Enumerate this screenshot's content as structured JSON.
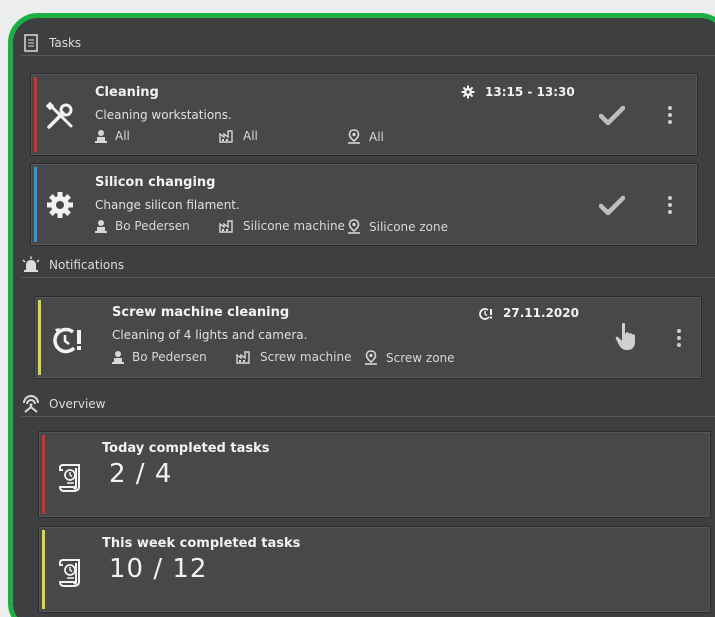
{
  "sections": {
    "tasks": "Tasks",
    "notifications": "Notifications",
    "overview": "Overview"
  },
  "tasks": [
    {
      "title": "Cleaning",
      "description": "Cleaning workstations.",
      "time": "13:15 - 13:30",
      "person": "All",
      "machine": "All",
      "zone": "All",
      "stripe_color": "#d32f2f",
      "icon": "tools-icon"
    },
    {
      "title": "Silicon changing",
      "description": "Change silicon filament.",
      "time": "",
      "person": "Bo Pedersen",
      "machine": "Silicone machine",
      "zone": "Silicone zone",
      "stripe_color": "#2f9ad3",
      "icon": "gear-icon"
    }
  ],
  "notifications": [
    {
      "title": "Screw machine cleaning",
      "description": "Cleaning of 4 lights and camera.",
      "date": "27.11.2020",
      "person": "Bo Pedersen",
      "machine": "Screw machine",
      "zone": "Screw zone",
      "stripe_color": "#d8d840",
      "icon": "alarm-clock-icon"
    }
  ],
  "overview": [
    {
      "title": "Today completed tasks",
      "value": "2 / 4",
      "stripe_color": "#d32f2f",
      "icon": "task-scroll-icon"
    },
    {
      "title": "This week completed tasks",
      "value": "10 / 12",
      "stripe_color": "#d8d840",
      "icon": "task-scroll-icon"
    }
  ],
  "colors": {
    "frame": "#1bb041",
    "panel": "#3d3f41",
    "card": "#464849"
  }
}
